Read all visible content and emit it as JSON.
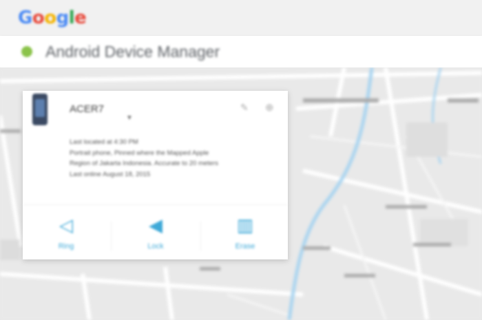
{
  "header": {
    "logo_letters": [
      "G",
      "o",
      "o",
      "g",
      "l",
      "e"
    ]
  },
  "app": {
    "title": "Android Device Manager",
    "icon": "android-icon"
  },
  "device": {
    "name": "ACER7",
    "icon": "phone-icon",
    "location_lines": [
      "Last located at 4:30 PM",
      "Portrait phone, Pinned where the Mapped Apple",
      "Region of Jakarta Indonesia. Accurate to 20 meters",
      "Last online August 18, 2015"
    ]
  },
  "actions": [
    {
      "label": "Ring",
      "icon": "ring-icon",
      "glyph": "◁"
    },
    {
      "label": "Lock",
      "icon": "lock-icon",
      "glyph": "◀"
    },
    {
      "label": "Erase",
      "icon": "erase-icon",
      "glyph": "▥"
    }
  ],
  "colors": {
    "accent": "#3fa9d8",
    "map_background": "#e9e9e9",
    "water": "#a8d4f0"
  }
}
